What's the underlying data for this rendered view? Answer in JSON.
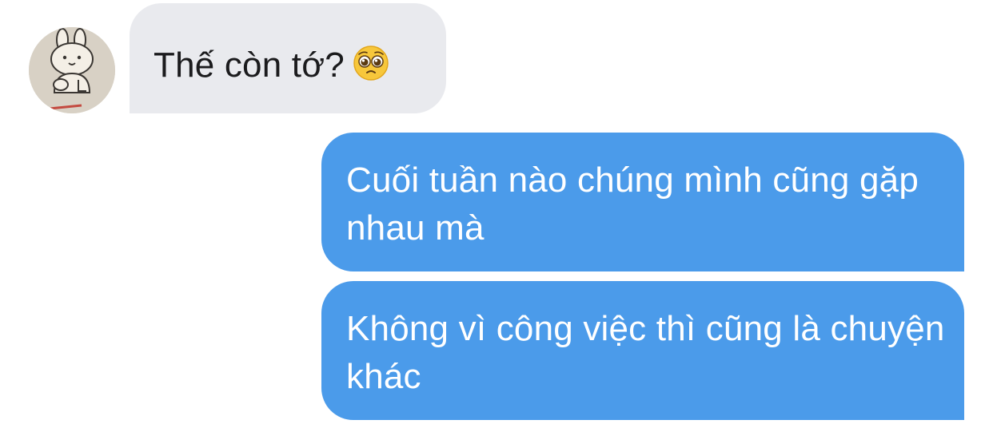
{
  "conversation": {
    "incoming": [
      {
        "text": "Thế còn tớ?",
        "emoji": "pleading-face"
      }
    ],
    "outgoing": [
      {
        "text": "Cuối tuần nào chúng mình cũng gặp nhau mà"
      },
      {
        "text": "Không vì công việc thì cũng là chuyện khác"
      }
    ]
  },
  "colors": {
    "incoming_bubble": "#e9eaee",
    "outgoing_bubble": "#4b9bea",
    "incoming_text": "#1b1b1d",
    "outgoing_text": "#ffffff"
  }
}
